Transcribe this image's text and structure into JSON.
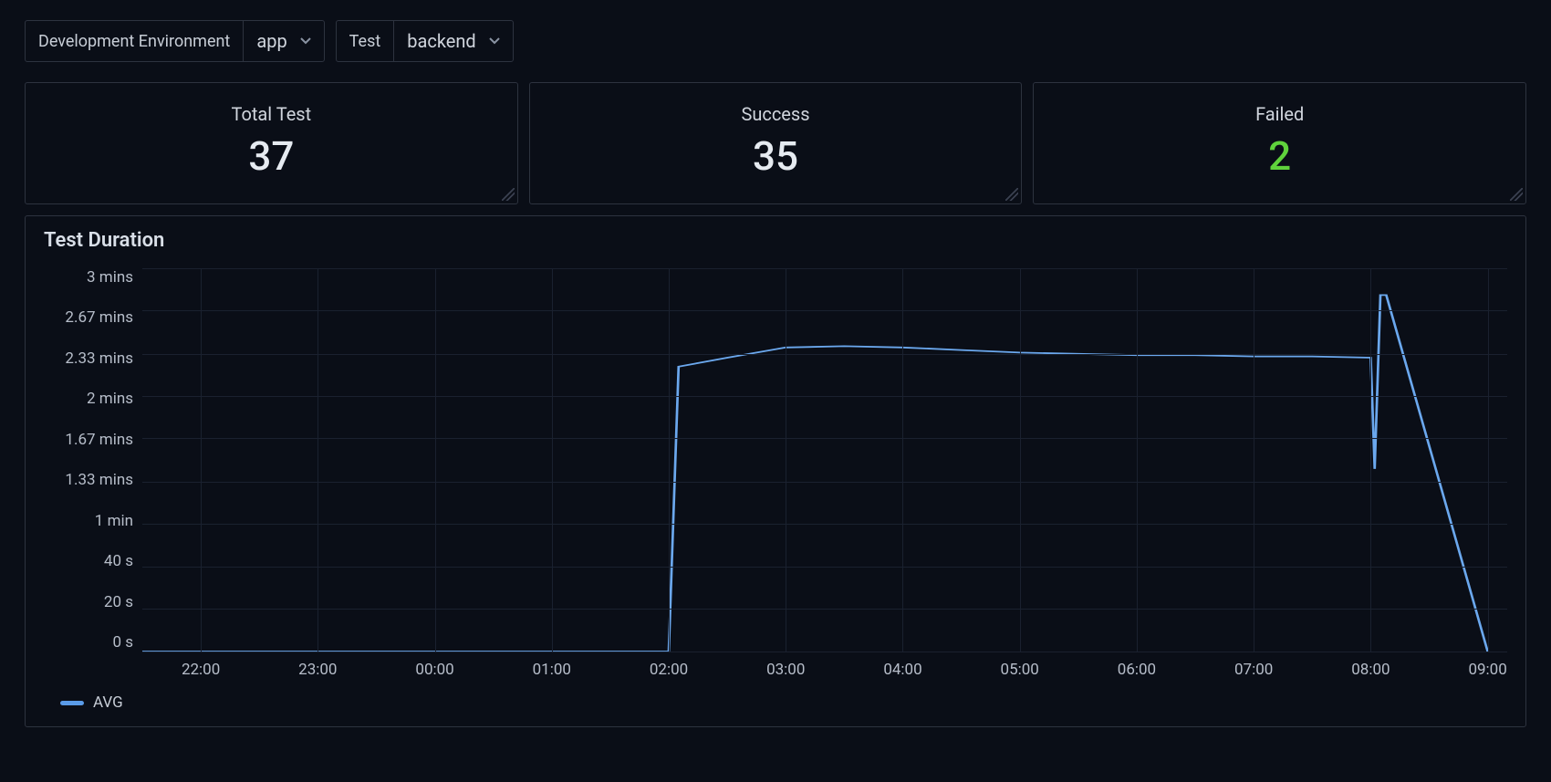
{
  "toolbar": {
    "env_picker": {
      "label": "Development Environment",
      "value": "app"
    },
    "test_picker": {
      "label": "Test",
      "value": "backend"
    }
  },
  "stats": {
    "total": {
      "title": "Total Test",
      "value": "37"
    },
    "success": {
      "title": "Success",
      "value": "35"
    },
    "failed": {
      "title": "Failed",
      "value": "2"
    }
  },
  "chart": {
    "title": "Test Duration",
    "legend": {
      "label": "AVG"
    },
    "y_ticks": [
      "3 mins",
      "2.67 mins",
      "2.33 mins",
      "2 mins",
      "1.67 mins",
      "1.33 mins",
      "1 min",
      "40 s",
      "20 s",
      "0 s"
    ],
    "x_ticks": [
      "22:00",
      "23:00",
      "00:00",
      "01:00",
      "02:00",
      "03:00",
      "04:00",
      "05:00",
      "06:00",
      "07:00",
      "08:00",
      "09:00"
    ]
  },
  "chart_data": {
    "type": "line",
    "title": "Test Duration",
    "xlabel": "",
    "ylabel": "",
    "ylim": [
      0,
      3
    ],
    "y_tick_values_minutes": [
      3,
      2.67,
      2.33,
      2,
      1.67,
      1.33,
      1,
      0.667,
      0.333,
      0
    ],
    "x": [
      "21:30",
      "22:00",
      "22:30",
      "23:00",
      "23:30",
      "00:00",
      "00:30",
      "01:00",
      "01:30",
      "02:00",
      "02:05",
      "02:30",
      "03:00",
      "03:30",
      "04:00",
      "04:30",
      "05:00",
      "05:30",
      "06:00",
      "06:30",
      "07:00",
      "07:30",
      "08:00",
      "08:02",
      "08:05",
      "08:08",
      "09:00"
    ],
    "series": [
      {
        "name": "AVG",
        "values_minutes": [
          0,
          0,
          0,
          0,
          0,
          0,
          0,
          0,
          0,
          0,
          2.23,
          2.3,
          2.38,
          2.39,
          2.38,
          2.36,
          2.34,
          2.33,
          2.32,
          2.32,
          2.31,
          2.31,
          2.3,
          1.43,
          2.79,
          2.79,
          0
        ]
      }
    ],
    "legend_position": "bottom-left",
    "grid": true
  }
}
